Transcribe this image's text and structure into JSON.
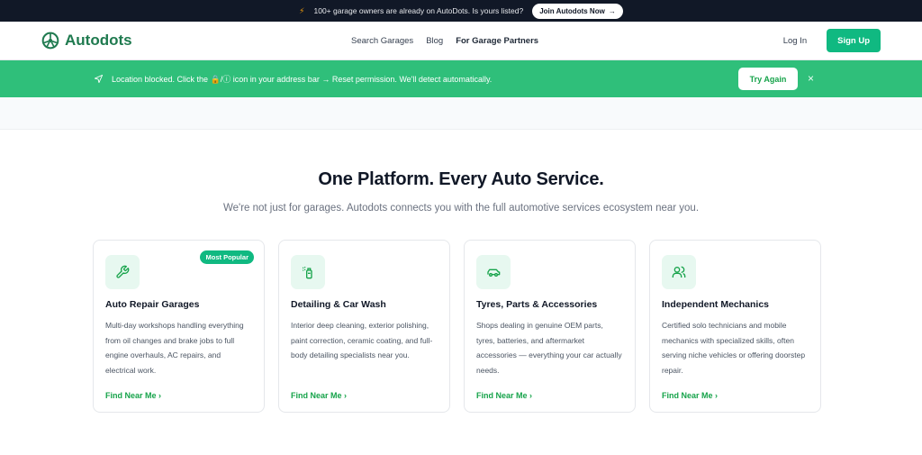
{
  "announcement": {
    "text": "100+ garage owners are already on AutoDots. Is yours listed?",
    "button": "Join Autodots Now",
    "button_icon": "arrow-right-icon"
  },
  "nav": {
    "logo": "Autodots",
    "links": [
      "Search Garages",
      "Blog",
      "For Garage Partners"
    ],
    "login": "Log In",
    "signup": "Sign Up"
  },
  "alert": {
    "text": "Location blocked. Click the 🔒/ⓘ icon in your address bar → Reset permission. We'll detect automatically.",
    "button": "Try Again",
    "close": "×"
  },
  "hero": {
    "title": "One Platform. Every Auto Service.",
    "subtitle": "We're not just for garages. Autodots connects you with the full automotive services ecosystem near you."
  },
  "cards": [
    {
      "icon": "wrench-icon",
      "title": "Auto Repair Garages",
      "badge": "Most Popular",
      "desc": "Multi-day workshops handling everything from oil changes and brake jobs to full engine overhauls, AC repairs, and electrical work.",
      "link": "Find Near Me ›"
    },
    {
      "icon": "spray-bottle-icon",
      "title": "Detailing & Car Wash",
      "desc": "Interior deep cleaning, exterior polishing, paint correction, ceramic coating, and full-body detailing specialists near you.",
      "link": "Find Near Me ›"
    },
    {
      "icon": "car-icon",
      "title": "Tyres, Parts & Accessories",
      "desc": "Shops dealing in genuine OEM parts, tyres, batteries, and aftermarket accessories — everything your car actually needs.",
      "link": "Find Near Me ›"
    },
    {
      "icon": "users-icon",
      "title": "Independent Mechanics",
      "desc": "Certified solo technicians and mobile mechanics with specialized skills, often serving niche vehicles or offering doorstep repair.",
      "link": "Find Near Me ›"
    }
  ],
  "colors": {
    "brand": "#10b981",
    "alert_bg": "#2fbf7a",
    "logo": "#1f7a4f",
    "topbar": "#111827"
  }
}
